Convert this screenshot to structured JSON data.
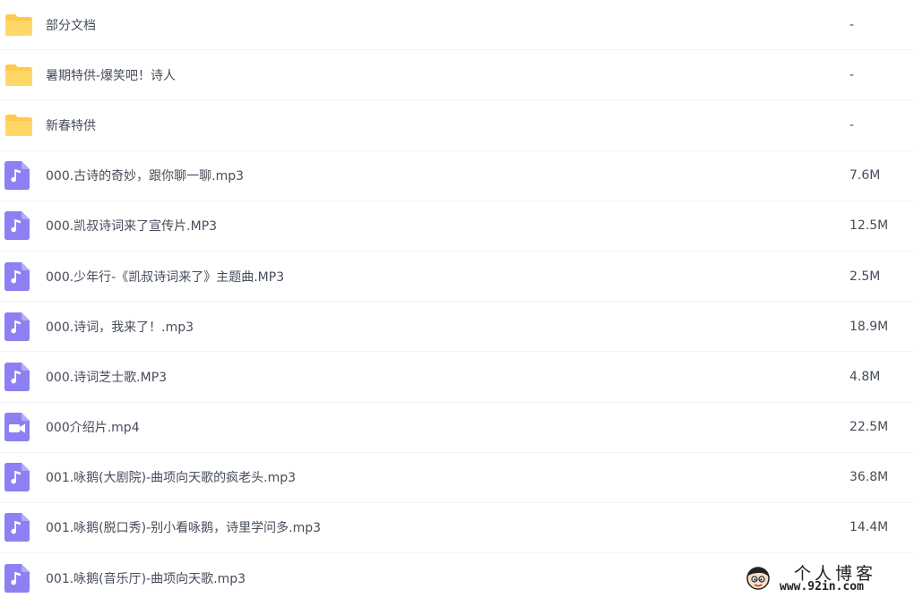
{
  "colors": {
    "folder": "#ffc94d",
    "audio": "#8c80f2",
    "video": "#8c80f2",
    "text": "#454d5a",
    "divider": "#f1f2f4"
  },
  "files": [
    {
      "type": "folder",
      "icon": "folder-icon",
      "name": "部分文档",
      "size": "-"
    },
    {
      "type": "folder",
      "icon": "folder-icon",
      "name": "暑期特供-爆笑吧！诗人",
      "size": "-"
    },
    {
      "type": "folder",
      "icon": "folder-icon",
      "name": "新春特供",
      "size": "-"
    },
    {
      "type": "audio",
      "icon": "music-note-icon",
      "name": "000.古诗的奇妙，跟你聊一聊.mp3",
      "size": "7.6M"
    },
    {
      "type": "audio",
      "icon": "music-note-icon",
      "name": "000.凯叔诗词来了宣传片.MP3",
      "size": "12.5M"
    },
    {
      "type": "audio",
      "icon": "music-note-icon",
      "name": "000.少年行-《凯叔诗词来了》主题曲.MP3",
      "size": "2.5M"
    },
    {
      "type": "audio",
      "icon": "music-note-icon",
      "name": "000.诗词，我来了！.mp3",
      "size": "18.9M"
    },
    {
      "type": "audio",
      "icon": "music-note-icon",
      "name": "000.诗词芝士歌.MP3",
      "size": "4.8M"
    },
    {
      "type": "video",
      "icon": "video-camera-icon",
      "name": "000介绍片.mp4",
      "size": "22.5M"
    },
    {
      "type": "audio",
      "icon": "music-note-icon",
      "name": "001.咏鹅(大剧院)-曲项向天歌的疯老头.mp3",
      "size": "36.8M"
    },
    {
      "type": "audio",
      "icon": "music-note-icon",
      "name": "001.咏鹅(脱口秀)-别小看咏鹅，诗里学问多.mp3",
      "size": "14.4M"
    },
    {
      "type": "audio",
      "icon": "music-note-icon",
      "name": "001.咏鹅(音乐厅)-曲项向天歌.mp3",
      "size": ""
    }
  ],
  "watermark": {
    "title": "个人博客",
    "url": "www.92in.com",
    "icon": "mascot-icon"
  }
}
